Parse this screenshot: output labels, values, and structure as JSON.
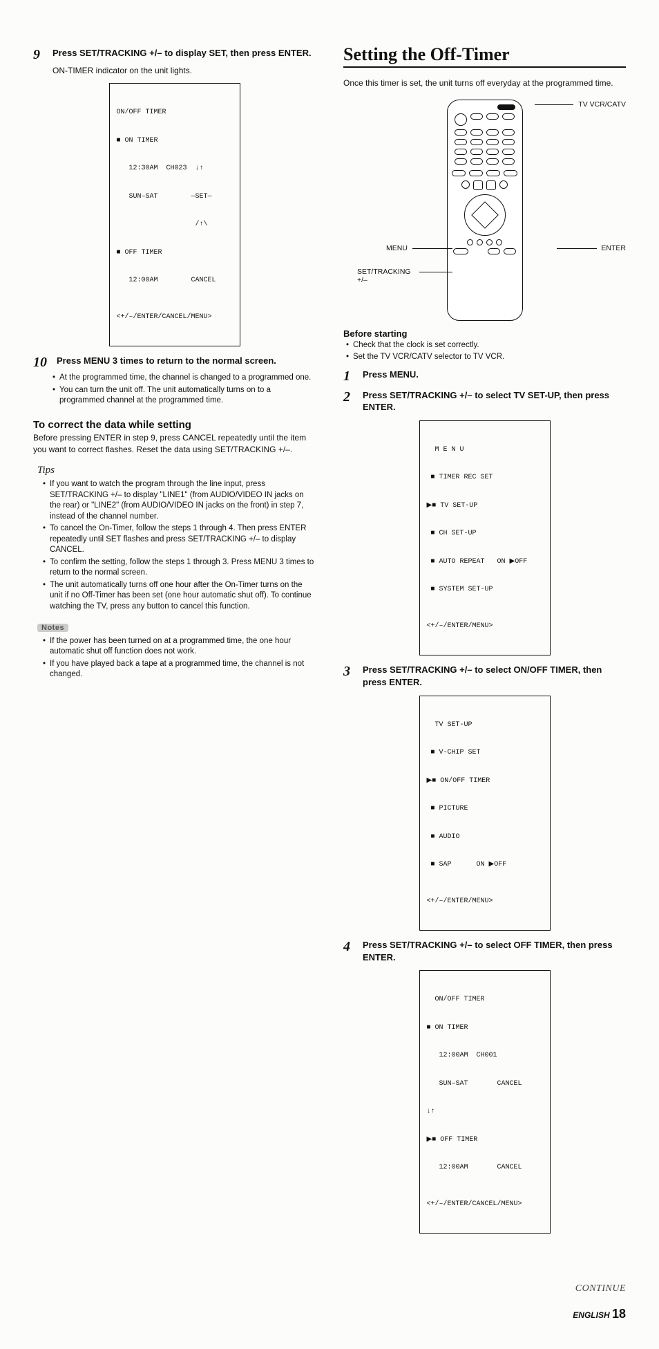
{
  "left": {
    "step9": {
      "num": "9",
      "text": "Press SET/TRACKING +/– to display SET, then press ENTER.",
      "sub": "ON-TIMER indicator on the unit lights."
    },
    "osd9": {
      "l1": "ON/OFF TIMER",
      "l2": "■ ON TIMER",
      "l3": "   12:30AM  CH023  ↓↑",
      "l4": "   SUN–SAT        —SET—",
      "l5": "                   /↑\\",
      "l6": "■ OFF TIMER",
      "l7": "   12:00AM        CANCEL",
      "footer": "<+/–/ENTER/CANCEL/MENU>"
    },
    "step10": {
      "num": "10",
      "text": "Press MENU 3 times to return to the normal screen.",
      "b1": "At the programmed time, the channel is changed to a programmed one.",
      "b2": "You can turn the unit off. The unit automatically turns on to a programmed channel at the programmed time."
    },
    "correct": {
      "title": "To correct the data while setting",
      "body": "Before pressing ENTER in step 9, press CANCEL repeatedly until the item you want to correct flashes. Reset the data using SET/TRACKING +/–."
    },
    "tipsLabel": "Tips",
    "tips": {
      "b1": "If you want to watch the program through the line input, press SET/TRACKING +/– to display \"LINE1\" (from AUDIO/VIDEO IN jacks on the rear) or \"LINE2\" (from AUDIO/VIDEO IN jacks on the front) in step 7, instead of the channel number.",
      "b2": "To cancel the On-Timer, follow the steps 1 through 4. Then press ENTER repeatedly until SET flashes and press SET/TRACKING +/– to display CANCEL.",
      "b3": "To confirm the setting, follow the steps 1 through 3. Press MENU 3 times to return to the normal screen.",
      "b4": "The unit automatically turns off one hour after the On-Timer turns on the unit if no Off-Timer has been set (one hour automatic shut off). To continue watching the TV, press any button to cancel this function."
    },
    "notesLabel": "Notes",
    "notes": {
      "b1": "If the power has been turned on at a programmed time, the one hour automatic shut off function does not work.",
      "b2": "If you have played back a tape at a programmed time, the channel is not changed."
    }
  },
  "right": {
    "title": "Setting the Off-Timer",
    "intro": "Once this timer is set, the unit turns off everyday at the programmed time.",
    "labels": {
      "tvvcr": "TV VCR/CATV",
      "menu": "MENU",
      "enter": "ENTER",
      "settrack": "SET/TRACKING\n+/–"
    },
    "before": {
      "title": "Before starting",
      "b1": "Check that the clock is set correctly.",
      "b2": "Set the TV VCR/CATV selector to TV VCR."
    },
    "step1": {
      "num": "1",
      "text": "Press MENU."
    },
    "step2": {
      "num": "2",
      "text": "Press SET/TRACKING +/– to select TV SET-UP, then press ENTER."
    },
    "osd2": {
      "l1": "  M E N U",
      "l2": " ■ TIMER REC SET",
      "l3": "▶■ TV SET-UP",
      "l4": " ■ CH SET-UP",
      "l5": " ■ AUTO REPEAT   ON ▶OFF",
      "l6": " ■ SYSTEM SET-UP",
      "footer": "<+/–/ENTER/MENU>"
    },
    "step3": {
      "num": "3",
      "text": "Press SET/TRACKING +/– to select ON/OFF TIMER, then press ENTER."
    },
    "osd3": {
      "l1": "  TV SET-UP",
      "l2": " ■ V-CHIP SET",
      "l3": "▶■ ON/OFF TIMER",
      "l4": " ■ PICTURE",
      "l5": " ■ AUDIO",
      "l6": " ■ SAP      ON ▶OFF",
      "footer": "<+/–/ENTER/MENU>"
    },
    "step4": {
      "num": "4",
      "text": "Press SET/TRACKING +/– to select OFF TIMER, then press ENTER."
    },
    "osd4": {
      "l1": "  ON/OFF TIMER",
      "l2": "■ ON TIMER",
      "l3": "   12:00AM  CH001",
      "l4": "   SUN–SAT       CANCEL",
      "l5": "↓↑",
      "l6": "▶■ OFF TIMER",
      "l7": "   12:00AM       CANCEL",
      "footer": "<+/–/ENTER/CANCEL/MENU>"
    }
  },
  "footer": {
    "continue": "CONTINUE",
    "lang": "ENGLISH",
    "page": "18"
  }
}
